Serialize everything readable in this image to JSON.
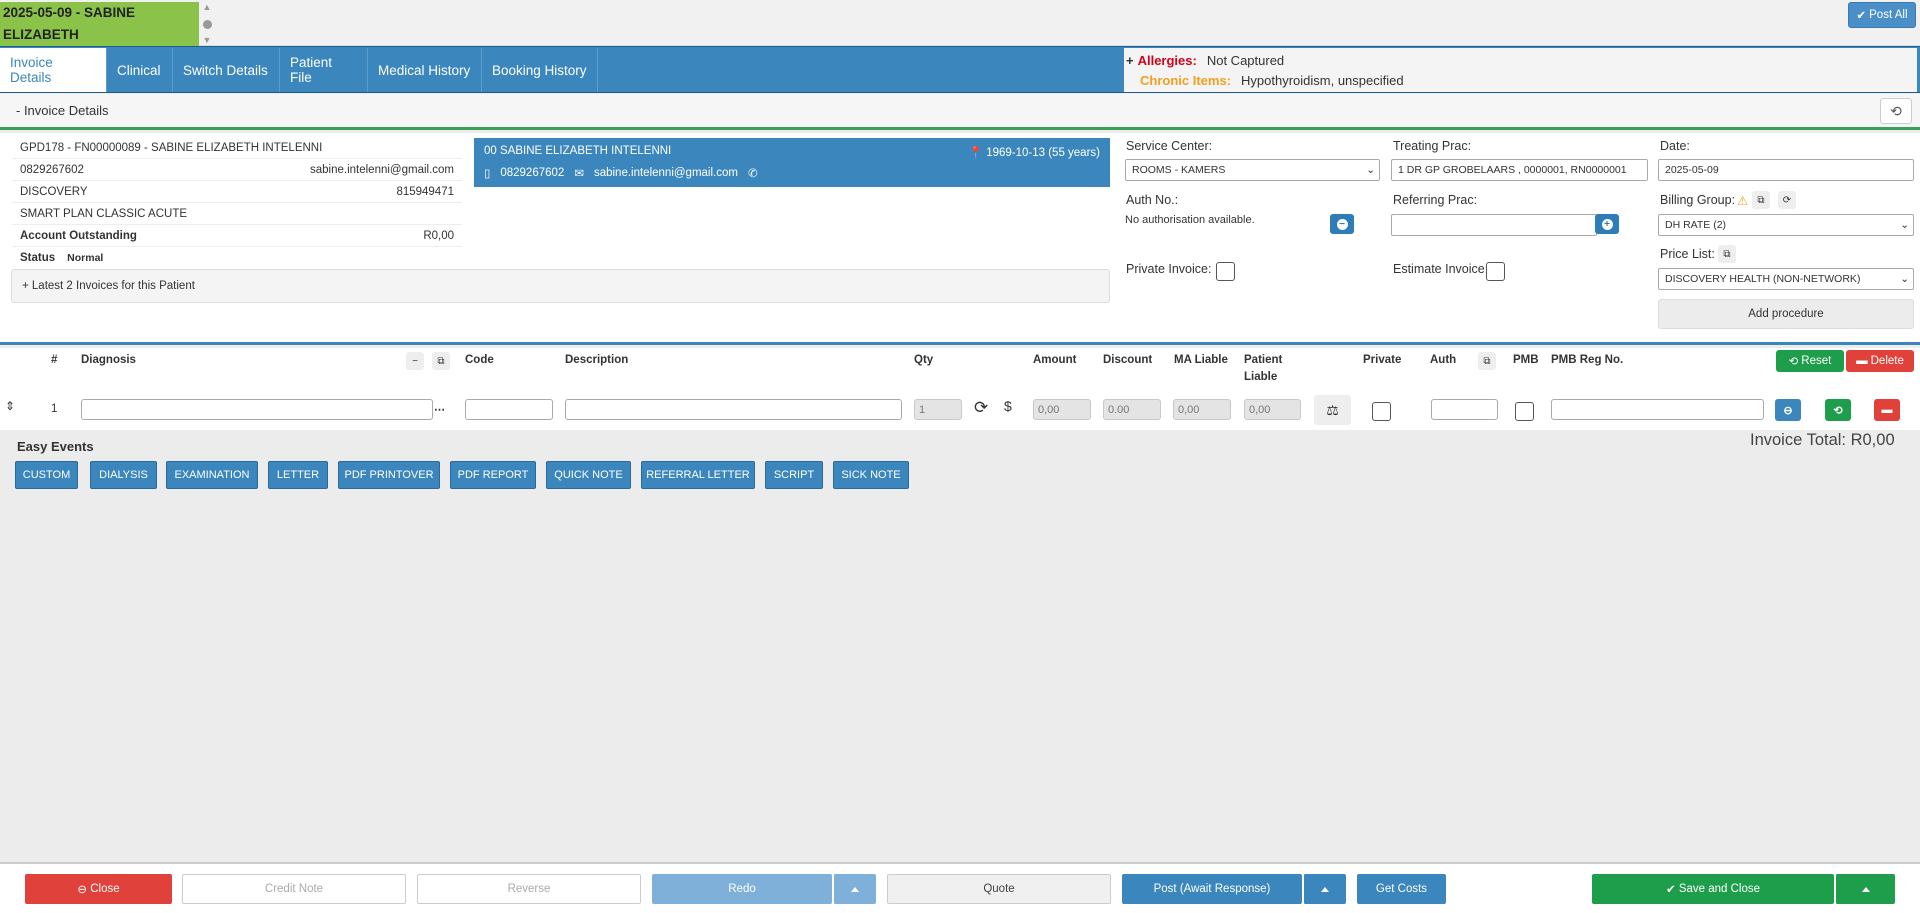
{
  "topbar": {
    "patient_tag": "2025-05-09 - SABINE ELIZABETH",
    "post_all": "Post All"
  },
  "tabs": [
    "Invoice Details",
    "Clinical",
    "Switch Details",
    "Patient File",
    "Medical History",
    "Booking History"
  ],
  "alerts": {
    "allergies_label": "Allergies:",
    "allergies_value": "Not Captured",
    "chronic_label": "Chronic Items:",
    "chronic_value": "Hypothyroidism, unspecified"
  },
  "section": {
    "title": "- Invoice Details"
  },
  "patient": {
    "id_line": "GPD178 -  FN00000089  -  SABINE ELIZABETH INTELENNI",
    "phone": "0829267602",
    "email": "sabine.intelenni@gmail.com",
    "scheme": "DISCOVERY",
    "member_no": "815949471",
    "plan": "SMART PLAN CLASSIC ACUTE",
    "outstanding_label": "Account Outstanding",
    "outstanding_value": "R0,00",
    "status_label": "Status",
    "status_value": "Normal",
    "latest_invoices": "+ Latest 2 Invoices for this Patient"
  },
  "card": {
    "name": "00 SABINE ELIZABETH INTELENNI",
    "dob": "1969-10-13 (55 years)",
    "phone": "0829267602",
    "email": "sabine.intelenni@gmail.com"
  },
  "form": {
    "service_center_label": "Service Center:",
    "service_center_value": "ROOMS - KAMERS",
    "treating_prac_label": "Treating Prac:",
    "treating_prac_value": "1 DR GP GROBELAARS , 0000001, RN0000001",
    "date_label": "Date:",
    "date_value": "2025-05-09",
    "auth_label": "Auth No.:",
    "auth_value": "No authorisation available.",
    "referring_label": "Referring Prac:",
    "billing_group_label": "Billing Group:",
    "billing_group_value": "DH RATE (2)",
    "private_invoice_label": "Private Invoice:",
    "estimate_invoice_label": "Estimate Invoice:",
    "price_list_label": "Price List:",
    "price_list_value": "DISCOVERY HEALTH (NON-NETWORK)",
    "add_procedure": "Add procedure"
  },
  "grid": {
    "headers": {
      "num": "#",
      "diagnosis": "Diagnosis",
      "code": "Code",
      "description": "Description",
      "qty": "Qty",
      "amount": "Amount",
      "discount": "Discount",
      "ma_liable": "MA Liable",
      "patient_liable_1": "Patient",
      "patient_liable_2": "Liable",
      "private": "Private",
      "auth": "Auth",
      "pmb": "PMB",
      "pmb_reg": "PMB Reg No."
    },
    "reset": "Reset",
    "delete": "Delete",
    "row": {
      "num": "1",
      "qty": "1",
      "amount": "0,00",
      "discount": "0.00",
      "ma_liable": "0,00",
      "patient_liable": "0,00"
    }
  },
  "easy_events": {
    "title": "Easy Events",
    "invoice_total": "Invoice Total: R0,00",
    "buttons": [
      "CUSTOM",
      "DIALYSIS",
      "EXAMINATION",
      "LETTER",
      "PDF PRINTOVER",
      "PDF REPORT",
      "QUICK NOTE",
      "REFERRAL LETTER",
      "SCRIPT",
      "SICK NOTE"
    ]
  },
  "footer": {
    "close": "Close",
    "credit_note": "Credit Note",
    "reverse": "Reverse",
    "redo": "Redo",
    "quote": "Quote",
    "post": "Post (Await Response)",
    "get_costs": "Get Costs",
    "save_close": "Save and Close"
  },
  "colors": {
    "primary_blue": "#3a86bd",
    "green_tag": "#8bc34a",
    "danger": "#e0413a",
    "success": "#1e9e4a",
    "allergy_red": "#d0021b",
    "chronic_orange": "#f0a020"
  }
}
